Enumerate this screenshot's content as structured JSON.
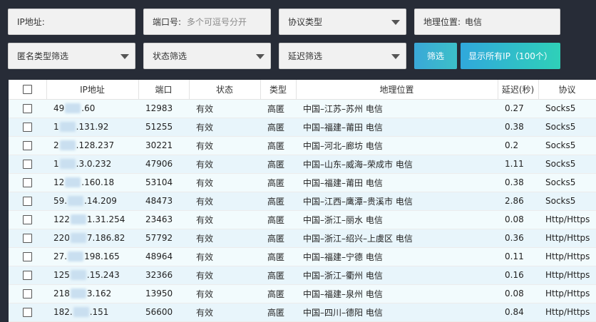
{
  "filters": {
    "ip_label": "IP地址:",
    "port_label": "端口号:",
    "port_placeholder": "多个可逗号分开",
    "protocol_select": "协议类型",
    "location_label": "地理位置:",
    "location_value": "电信",
    "anon_select": "匿名类型筛选",
    "status_select": "状态筛选",
    "latency_select": "延迟筛选",
    "filter_button": "筛选",
    "show_all_button": "显示所有IP（100个）"
  },
  "table": {
    "headers": [
      "",
      "IP地址",
      "端口",
      "状态",
      "类型",
      "地理位置",
      "延迟(秒)",
      "协议"
    ],
    "rows": [
      {
        "ip_a": "49",
        "ip_b": ".60",
        "port": "12983",
        "status": "有效",
        "type": "高匿",
        "loc": "中国–江苏–苏州 电信",
        "latency": "0.27",
        "proto": "Socks5"
      },
      {
        "ip_a": "1",
        "ip_b": ".131.92",
        "port": "51255",
        "status": "有效",
        "type": "高匿",
        "loc": "中国–福建–莆田 电信",
        "latency": "0.38",
        "proto": "Socks5"
      },
      {
        "ip_a": "2",
        "ip_b": ".128.237",
        "port": "30221",
        "status": "有效",
        "type": "高匿",
        "loc": "中国–河北–廊坊 电信",
        "latency": "0.2",
        "proto": "Socks5"
      },
      {
        "ip_a": "1",
        "ip_b": ".3.0.232",
        "port": "47906",
        "status": "有效",
        "type": "高匿",
        "loc": "中国–山东–威海–荣成市 电信",
        "latency": "1.11",
        "proto": "Socks5"
      },
      {
        "ip_a": "12",
        "ip_b": ".160.18",
        "port": "53104",
        "status": "有效",
        "type": "高匿",
        "loc": "中国–福建–莆田 电信",
        "latency": "0.38",
        "proto": "Socks5"
      },
      {
        "ip_a": "59.",
        "ip_b": ".14.209",
        "port": "48473",
        "status": "有效",
        "type": "高匿",
        "loc": "中国–江西–鹰潭–贵溪市 电信",
        "latency": "2.86",
        "proto": "Socks5"
      },
      {
        "ip_a": "122",
        "ip_b": "1.31.254",
        "port": "23463",
        "status": "有效",
        "type": "高匿",
        "loc": "中国–浙江–丽水 电信",
        "latency": "0.08",
        "proto": "Http/Https"
      },
      {
        "ip_a": "220",
        "ip_b": "7.186.82",
        "port": "57792",
        "status": "有效",
        "type": "高匿",
        "loc": "中国–浙江–绍兴–上虞区 电信",
        "latency": "0.36",
        "proto": "Http/Https"
      },
      {
        "ip_a": "27.",
        "ip_b": "198.165",
        "port": "48964",
        "status": "有效",
        "type": "高匿",
        "loc": "中国–福建–宁德 电信",
        "latency": "0.11",
        "proto": "Http/Https"
      },
      {
        "ip_a": "125",
        "ip_b": ".15.243",
        "port": "32366",
        "status": "有效",
        "type": "高匿",
        "loc": "中国–浙江–衢州 电信",
        "latency": "0.16",
        "proto": "Http/Https"
      },
      {
        "ip_a": "218",
        "ip_b": "3.162",
        "port": "13950",
        "status": "有效",
        "type": "高匿",
        "loc": "中国–福建–泉州 电信",
        "latency": "0.08",
        "proto": "Http/Https"
      },
      {
        "ip_a": "182.",
        "ip_b": ".151",
        "port": "56600",
        "status": "有效",
        "type": "高匿",
        "loc": "中国–四川–德阳 电信",
        "latency": "0.84",
        "proto": "Http/Https"
      }
    ]
  }
}
